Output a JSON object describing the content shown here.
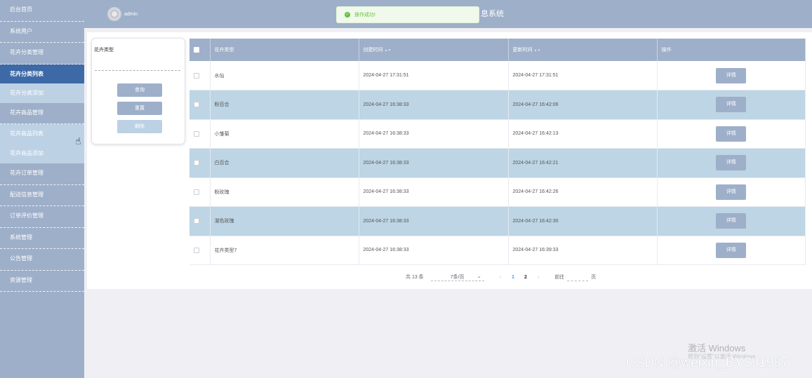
{
  "sidebar": {
    "items": [
      {
        "label": "后台首页"
      },
      {
        "label": "系统用户"
      },
      {
        "label": "花卉分类管理"
      },
      {
        "label": "花卉分类列表"
      },
      {
        "label": "花卉分类添加"
      },
      {
        "label": "花卉商品管理"
      },
      {
        "label": "花卉商品列表"
      },
      {
        "label": "花卉商品添加"
      },
      {
        "label": "花卉订单管理"
      },
      {
        "label": "配送信息管理"
      },
      {
        "label": "订单评价管理"
      },
      {
        "label": "系统管理"
      },
      {
        "label": "公告管理"
      },
      {
        "label": "资源管理"
      }
    ]
  },
  "header": {
    "username": "admin",
    "title_fragment": "息系统"
  },
  "toast": {
    "message": "操作成功!",
    "color": "#67c23a"
  },
  "search": {
    "label": "花卉类型",
    "placeholder": "",
    "query_label": "查询",
    "reset_label": "重置",
    "delete_label": "删除"
  },
  "table": {
    "headers": {
      "type": "花卉类型",
      "created": "创建时间",
      "updated": "更新时间",
      "operation": "操作"
    },
    "detail_label": "详情",
    "rows": [
      {
        "type": "水仙",
        "created": "2024-04-27 17:31:51",
        "updated": "2024-04-27 17:31:51"
      },
      {
        "type": "粉百合",
        "created": "2024-04-27 16:38:33",
        "updated": "2024-04-27 16:42:06"
      },
      {
        "type": "小雏菊",
        "created": "2024-04-27 16:38:33",
        "updated": "2024-04-27 16:42:13"
      },
      {
        "type": "白百合",
        "created": "2024-04-27 16:38:33",
        "updated": "2024-04-27 16:42:21"
      },
      {
        "type": "粉玫瑰",
        "created": "2024-04-27 16:38:33",
        "updated": "2024-04-27 16:42:26"
      },
      {
        "type": "湛色玫瑰",
        "created": "2024-04-27 16:38:33",
        "updated": "2024-04-27 16:42:30"
      },
      {
        "type": "花卉类型7",
        "created": "2024-04-27 16:38:33",
        "updated": "2024-04-27 16:39:33"
      }
    ]
  },
  "pagination": {
    "total_text": "共 13 条",
    "page_size_text": "7条/页",
    "pages": [
      "1",
      "2"
    ],
    "current_page": "1",
    "goto_label": "前往",
    "page_suffix": "页"
  },
  "watermark": {
    "windows_title": "激活 Windows",
    "windows_sub": "转到\"设置\"以激活 Windows。",
    "csdn": "CSDN @weixin_BYSJ1987"
  },
  "colors": {
    "sidebar_bg": "#9eafc9",
    "active_nav": "#3d6aa6",
    "row_alt": "#bdd5e4",
    "button": "#9eafc9"
  }
}
